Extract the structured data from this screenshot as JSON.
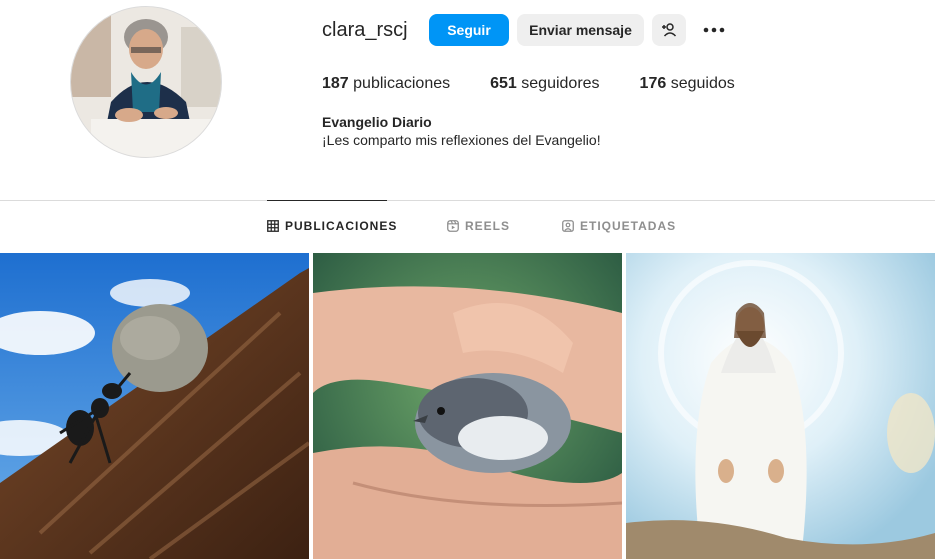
{
  "profile": {
    "username": "clara_rscj",
    "follow_label": "Seguir",
    "message_label": "Enviar mensaje",
    "add_user_icon": "add-user-icon",
    "more_icon": "more-options-icon"
  },
  "stats": {
    "posts_count": "187",
    "posts_label": "publicaciones",
    "followers_count": "651",
    "followers_label": "seguidores",
    "following_count": "176",
    "following_label": "seguidos"
  },
  "bio": {
    "name": "Evangelio Diario",
    "text": "¡Les comparto mis reflexiones del Evangelio!"
  },
  "tabs": [
    {
      "label": "PUBLICACIONES",
      "icon": "grid-icon",
      "active": true
    },
    {
      "label": "REELS",
      "icon": "reels-icon",
      "active": false
    },
    {
      "label": "ETIQUETADAS",
      "icon": "tagged-icon",
      "active": false
    }
  ],
  "posts": [
    {
      "subject": "ant-pushing-stone"
    },
    {
      "subject": "bird-in-hands"
    },
    {
      "subject": "jesus-in-light"
    }
  ],
  "colors": {
    "primary_button": "#0095f6",
    "secondary_button": "#efefef",
    "text": "#262626",
    "muted": "#8e8e8e",
    "divider": "#dbdbdb"
  }
}
